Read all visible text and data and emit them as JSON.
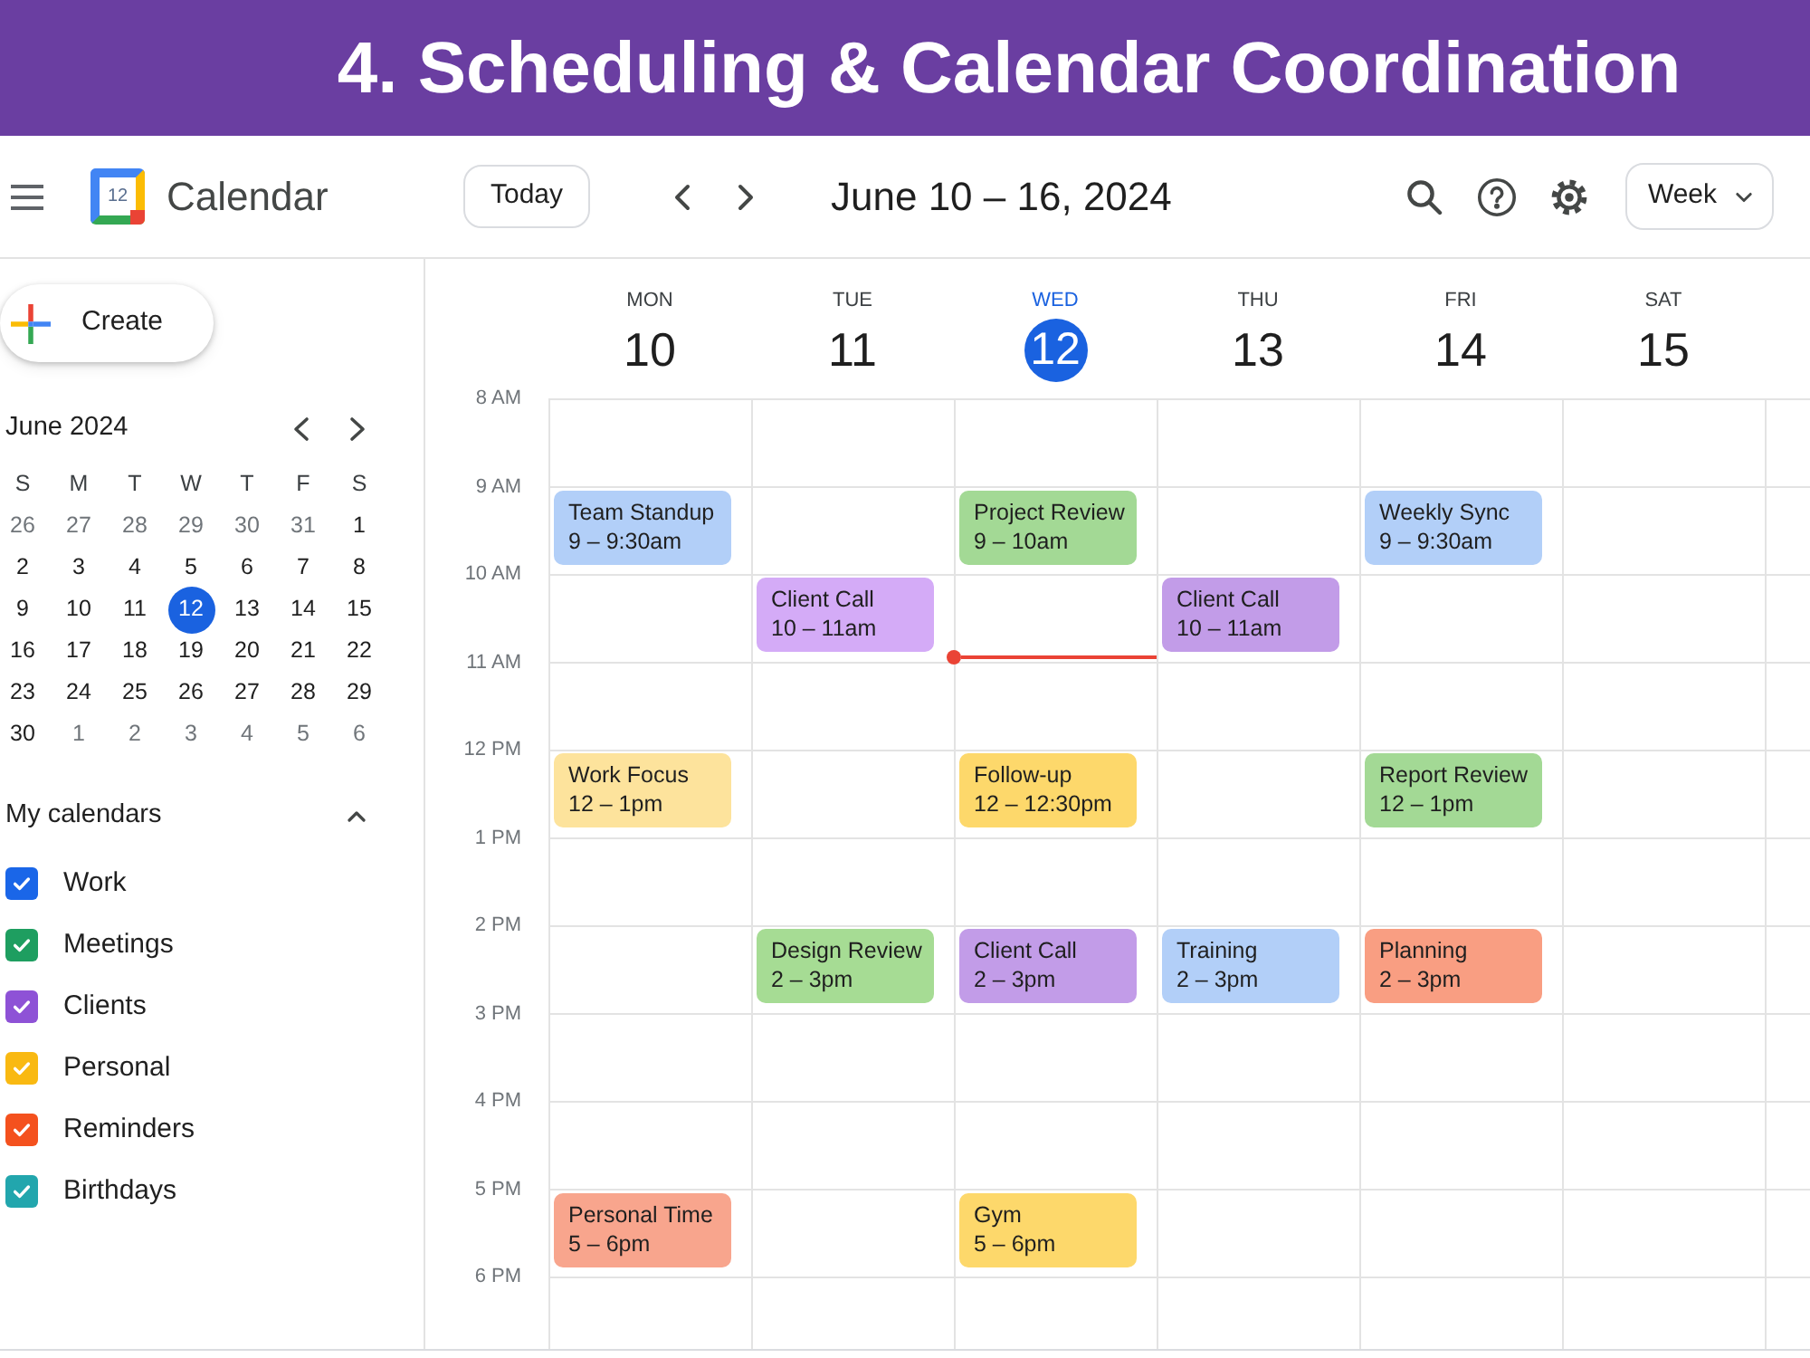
{
  "banner": {
    "title": "4. Scheduling & Calendar Coordination"
  },
  "header": {
    "logo_date": "12",
    "app_name": "Calendar",
    "today_button": "Today",
    "date_range": "June 10 – 16, 2024",
    "view_select": "Week"
  },
  "sidebar": {
    "create_button": "Create",
    "mini_calendar": {
      "title": "June 2024",
      "weekdays": [
        "S",
        "M",
        "T",
        "W",
        "T",
        "F",
        "S"
      ],
      "weeks": [
        [
          {
            "label": "26",
            "outside": true,
            "selected": false
          },
          {
            "label": "27",
            "outside": true,
            "selected": false
          },
          {
            "label": "28",
            "outside": true,
            "selected": false
          },
          {
            "label": "29",
            "outside": true,
            "selected": false
          },
          {
            "label": "30",
            "outside": true,
            "selected": false
          },
          {
            "label": "31",
            "outside": true,
            "selected": false
          },
          {
            "label": "1",
            "outside": false,
            "selected": false
          }
        ],
        [
          {
            "label": "2",
            "outside": false,
            "selected": false
          },
          {
            "label": "3",
            "outside": false,
            "selected": false
          },
          {
            "label": "4",
            "outside": false,
            "selected": false
          },
          {
            "label": "5",
            "outside": false,
            "selected": false
          },
          {
            "label": "6",
            "outside": false,
            "selected": false
          },
          {
            "label": "7",
            "outside": false,
            "selected": false
          },
          {
            "label": "8",
            "outside": false,
            "selected": false
          }
        ],
        [
          {
            "label": "9",
            "outside": false,
            "selected": false
          },
          {
            "label": "10",
            "outside": false,
            "selected": false
          },
          {
            "label": "11",
            "outside": false,
            "selected": false
          },
          {
            "label": "12",
            "outside": false,
            "selected": true
          },
          {
            "label": "13",
            "outside": false,
            "selected": false
          },
          {
            "label": "14",
            "outside": false,
            "selected": false
          },
          {
            "label": "15",
            "outside": false,
            "selected": false
          }
        ],
        [
          {
            "label": "16",
            "outside": false,
            "selected": false
          },
          {
            "label": "17",
            "outside": false,
            "selected": false
          },
          {
            "label": "18",
            "outside": false,
            "selected": false
          },
          {
            "label": "19",
            "outside": false,
            "selected": false
          },
          {
            "label": "20",
            "outside": false,
            "selected": false
          },
          {
            "label": "21",
            "outside": false,
            "selected": false
          },
          {
            "label": "22",
            "outside": false,
            "selected": false
          }
        ],
        [
          {
            "label": "23",
            "outside": false,
            "selected": false
          },
          {
            "label": "24",
            "outside": false,
            "selected": false
          },
          {
            "label": "25",
            "outside": false,
            "selected": false
          },
          {
            "label": "26",
            "outside": false,
            "selected": false
          },
          {
            "label": "27",
            "outside": false,
            "selected": false
          },
          {
            "label": "28",
            "outside": false,
            "selected": false
          },
          {
            "label": "29",
            "outside": false,
            "selected": false
          }
        ],
        [
          {
            "label": "30",
            "outside": false,
            "selected": false
          },
          {
            "label": "1",
            "outside": true,
            "selected": false
          },
          {
            "label": "2",
            "outside": true,
            "selected": false
          },
          {
            "label": "3",
            "outside": true,
            "selected": false
          },
          {
            "label": "4",
            "outside": true,
            "selected": false
          },
          {
            "label": "5",
            "outside": true,
            "selected": false
          },
          {
            "label": "6",
            "outside": true,
            "selected": false
          }
        ]
      ]
    },
    "my_calendars": {
      "title": "My calendars",
      "expanded": true,
      "items": [
        {
          "label": "Work",
          "checked": true,
          "color": "#1a66e8"
        },
        {
          "label": "Meetings",
          "checked": true,
          "color": "#1e9e60"
        },
        {
          "label": "Clients",
          "checked": true,
          "color": "#8e52d6"
        },
        {
          "label": "Personal",
          "checked": true,
          "color": "#f9b912"
        },
        {
          "label": "Reminders",
          "checked": true,
          "color": "#f4511e"
        },
        {
          "label": "Birthdays",
          "checked": true,
          "color": "#22a6ad"
        }
      ]
    }
  },
  "week": {
    "days": [
      {
        "name": "MON",
        "date": "10",
        "today": false
      },
      {
        "name": "TUE",
        "date": "11",
        "today": false
      },
      {
        "name": "WED",
        "date": "12",
        "today": true
      },
      {
        "name": "THU",
        "date": "13",
        "today": false
      },
      {
        "name": "FRI",
        "date": "14",
        "today": false
      },
      {
        "name": "SAT",
        "date": "15",
        "today": false
      }
    ],
    "rows": [
      {
        "time": "8 AM",
        "cells": [
          {
            "kind": "empty"
          },
          {
            "kind": "empty"
          },
          {
            "kind": "empty"
          },
          {
            "kind": "empty"
          },
          {
            "kind": "empty"
          },
          {
            "kind": "empty"
          },
          {
            "kind": "empty"
          }
        ]
      },
      {
        "time": "9 AM",
        "cells": [
          {
            "kind": "event",
            "title": "Team Standup",
            "time": "9 – 9:30am",
            "color": "#b2cff8"
          },
          {
            "kind": "empty"
          },
          {
            "kind": "event",
            "title": "Project Review",
            "time": "9 – 10am",
            "color": "#a3d995"
          },
          {
            "kind": "empty"
          },
          {
            "kind": "event",
            "title": "Weekly Sync",
            "time": "9 – 9:30am",
            "color": "#b2cff8"
          },
          {
            "kind": "empty"
          },
          {
            "kind": "empty"
          }
        ]
      },
      {
        "time": "10 AM",
        "cells": [
          {
            "kind": "empty"
          },
          {
            "kind": "event",
            "title": "Client Call",
            "time": "10 – 11am",
            "color": "#d4abf7"
          },
          {
            "kind": "now"
          },
          {
            "kind": "event",
            "title": "Client Call",
            "time": "10 – 11am",
            "color": "#c29ce8"
          },
          {
            "kind": "empty"
          },
          {
            "kind": "empty"
          },
          {
            "kind": "empty"
          }
        ]
      },
      {
        "time": "11 AM",
        "cells": [
          {
            "kind": "empty"
          },
          {
            "kind": "empty"
          },
          {
            "kind": "empty"
          },
          {
            "kind": "empty"
          },
          {
            "kind": "empty"
          },
          {
            "kind": "empty"
          },
          {
            "kind": "empty"
          }
        ]
      },
      {
        "time": "12 PM",
        "cells": [
          {
            "kind": "event",
            "title": "Work Focus",
            "time": "12 – 1pm",
            "color": "#fde39c"
          },
          {
            "kind": "empty"
          },
          {
            "kind": "event",
            "title": "Follow-up",
            "time": "12 – 12:30pm",
            "color": "#fdd86b"
          },
          {
            "kind": "empty"
          },
          {
            "kind": "event",
            "title": "Report Review",
            "time": "12 – 1pm",
            "color": "#a3d995"
          },
          {
            "kind": "empty"
          },
          {
            "kind": "empty"
          }
        ]
      },
      {
        "time": "1 PM",
        "cells": [
          {
            "kind": "empty"
          },
          {
            "kind": "empty"
          },
          {
            "kind": "empty"
          },
          {
            "kind": "empty"
          },
          {
            "kind": "empty"
          },
          {
            "kind": "empty"
          },
          {
            "kind": "empty"
          }
        ]
      },
      {
        "time": "2 PM",
        "cells": [
          {
            "kind": "empty"
          },
          {
            "kind": "event",
            "title": "Design Review",
            "time": "2 – 3pm",
            "color": "#a6dc94"
          },
          {
            "kind": "event",
            "title": "Client Call",
            "time": "2 – 3pm",
            "color": "#c29ce8"
          },
          {
            "kind": "event",
            "title": "Training",
            "time": "2 – 3pm",
            "color": "#b2cff8"
          },
          {
            "kind": "event",
            "title": "Planning",
            "time": "2 – 3pm",
            "color": "#f99e82"
          },
          {
            "kind": "empty"
          },
          {
            "kind": "empty"
          }
        ]
      },
      {
        "time": "3 PM",
        "cells": [
          {
            "kind": "empty"
          },
          {
            "kind": "empty"
          },
          {
            "kind": "empty"
          },
          {
            "kind": "empty"
          },
          {
            "kind": "empty"
          },
          {
            "kind": "empty"
          },
          {
            "kind": "empty"
          }
        ]
      },
      {
        "time": "4 PM",
        "cells": [
          {
            "kind": "empty"
          },
          {
            "kind": "empty"
          },
          {
            "kind": "empty"
          },
          {
            "kind": "empty"
          },
          {
            "kind": "empty"
          },
          {
            "kind": "empty"
          },
          {
            "kind": "empty"
          }
        ]
      },
      {
        "time": "5 PM",
        "cells": [
          {
            "kind": "event",
            "title": "Personal Time",
            "time": "5 – 6pm",
            "color": "#f8a58d"
          },
          {
            "kind": "empty"
          },
          {
            "kind": "event",
            "title": "Gym",
            "time": "5 – 6pm",
            "color": "#fdd86b"
          },
          {
            "kind": "empty"
          },
          {
            "kind": "empty"
          },
          {
            "kind": "empty"
          },
          {
            "kind": "empty"
          }
        ]
      },
      {
        "time": "6 PM",
        "cells": [
          {
            "kind": "empty"
          },
          {
            "kind": "empty"
          },
          {
            "kind": "empty"
          },
          {
            "kind": "empty"
          },
          {
            "kind": "empty"
          },
          {
            "kind": "empty"
          },
          {
            "kind": "empty"
          }
        ]
      }
    ]
  }
}
